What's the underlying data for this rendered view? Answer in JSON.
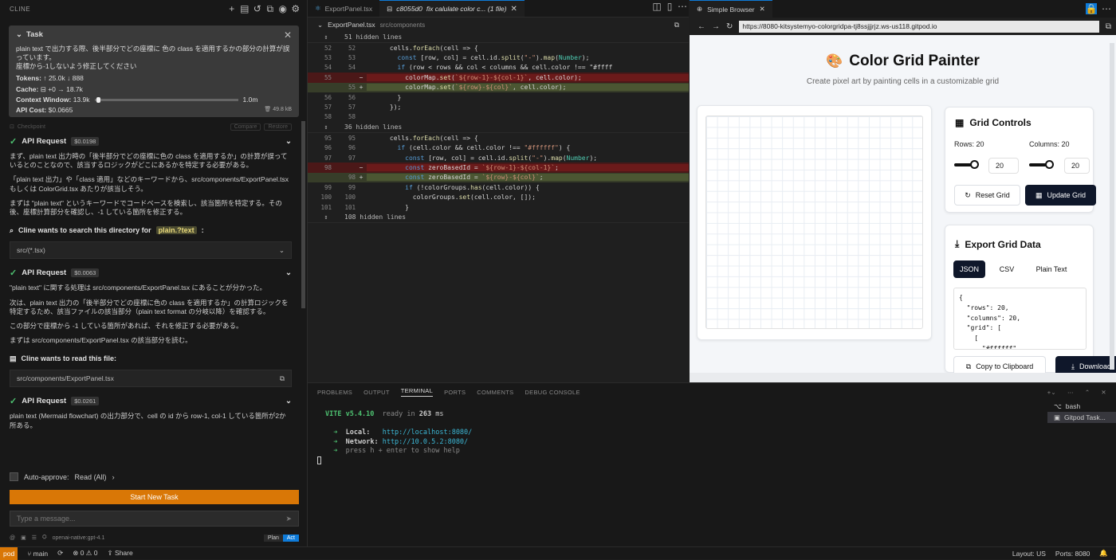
{
  "left": {
    "header_title": "CLINE",
    "task": {
      "title": "Task",
      "text_1": "plain text で出力する際、後半部分でどの座標に 色の class を適用するかの部分の計算が誤っています。",
      "text_2": "座標から-1しないよう修正してください",
      "tokens_label": "Tokens:",
      "tokens_value": "↑ 25.0k ↓ 888",
      "cache_label": "Cache:",
      "cache_value": "⊟ +0 → 18.7k",
      "context_label": "Context Window:",
      "context_used": "13.9k",
      "context_max": "1.0m",
      "context_fraction": 0.013,
      "cost_label": "API Cost:",
      "cost_value": "$0.0665",
      "size": "49.8 kB"
    },
    "checkpoint": {
      "label": "Checkpoint",
      "compare": "Compare",
      "restore": "Restore"
    },
    "chat": {
      "req1_title": "API Request",
      "req1_cost": "$0.0198",
      "msg1": "まず、plain text 出力時の「後半部分でどの座標に色の class を適用するか」の計算が誤っているとのことなので、該当するロジックがどこにあるかを特定する必要がある。",
      "msg2": "「plain text 出力」や「class 適用」などのキーワードから、src/components/ExportPanel.tsx もしくは ColorGrid.tsx あたりが該当しそう。",
      "msg3": "まずは \"plain text\" というキーワードでコードベースを検索し、該当箇所を特定する。その後、座標計算部分を確認し、-1 している箇所を修正する。",
      "search_title": "Cline wants to search this directory for",
      "search_term": "plain.?text",
      "search_pattern": "src/(*.tsx)",
      "req2_title": "API Request",
      "req2_cost": "$0.0063",
      "msg4": "\"plain text\" に関する処理は src/components/ExportPanel.tsx にあることが分かった。",
      "msg5": "次は、plain text 出力の「後半部分でどの座標に色の class を適用するか」の計算ロジックを特定するため、該当ファイルの該当部分（plain text format の分岐以降）を確認する。",
      "msg6": "この部分で座標から -1 している箇所があれば、それを修正する必要がある。",
      "msg7": "まずは src/components/ExportPanel.tsx の該当部分を読む。",
      "read_title": "Cline wants to read this file:",
      "read_path": "src/components/ExportPanel.tsx",
      "req3_title": "API Request",
      "req3_cost": "$0.0261",
      "msg8": "plain text (Mermaid flowchart) の出力部分で、cell の id から row-1, col-1 している箇所が2か所ある。"
    },
    "auto_approve": "Auto-approve:",
    "auto_approve_value": "Read (All)",
    "new_task": "Start New Task",
    "message_placeholder": "Type a message...",
    "model": "openai-native:gpt-4.1",
    "plan": "Plan",
    "act": "Act"
  },
  "editor": {
    "tab1": "ExportPanel.tsx",
    "tab2_hash": "c8055d0",
    "tab2_msg": "fix calulate color c... (1 file)",
    "file": "ExportPanel.tsx",
    "path": "src/components",
    "hidden1": "51 hidden lines",
    "hidden2": "36 hidden lines",
    "hidden3": "108 hidden lines",
    "lines": [
      {
        "a": "52",
        "b": "52",
        "m": "",
        "t": "normal",
        "code": "      cells.forEach(cell => {"
      },
      {
        "a": "53",
        "b": "53",
        "m": "",
        "t": "normal",
        "code": "        const [row, col] = cell.id.split(\"-\").map(Number);"
      },
      {
        "a": "54",
        "b": "54",
        "m": "",
        "t": "normal",
        "code": "        if (row < rows && col < columns && cell.color !== \"#ffff"
      },
      {
        "a": "55",
        "b": "",
        "m": "−",
        "t": "del",
        "code": "          colorMap.set(`${row-1}-${col-1}`, cell.color);"
      },
      {
        "a": "",
        "b": "55",
        "m": "+",
        "t": "add",
        "code": "          colorMap.set(`${row}-${col}`, cell.color);"
      },
      {
        "a": "56",
        "b": "56",
        "m": "",
        "t": "normal",
        "code": "        }"
      },
      {
        "a": "57",
        "b": "57",
        "m": "",
        "t": "normal",
        "code": "      });"
      },
      {
        "a": "58",
        "b": "58",
        "m": "",
        "t": "normal",
        "code": ""
      }
    ],
    "lines2": [
      {
        "a": "95",
        "b": "95",
        "m": "",
        "t": "normal",
        "code": "      cells.forEach(cell => {"
      },
      {
        "a": "96",
        "b": "96",
        "m": "",
        "t": "normal",
        "code": "        if (cell.color && cell.color !== \"#ffffff\") {"
      },
      {
        "a": "97",
        "b": "97",
        "m": "",
        "t": "normal",
        "code": "          const [row, col] = cell.id.split(\"-\").map(Number);"
      },
      {
        "a": "98",
        "b": "",
        "m": "−",
        "t": "del",
        "code": "          const zeroBasedId = `${row-1}-${col-1}`;"
      },
      {
        "a": "",
        "b": "98",
        "m": "+",
        "t": "add",
        "code": "          const zeroBasedId = `${row}-${col}`;"
      },
      {
        "a": "99",
        "b": "99",
        "m": "",
        "t": "normal",
        "code": "          if (!colorGroups.has(cell.color)) {"
      },
      {
        "a": "100",
        "b": "100",
        "m": "",
        "t": "normal",
        "code": "            colorGroups.set(cell.color, []);"
      },
      {
        "a": "101",
        "b": "101",
        "m": "",
        "t": "normal",
        "code": "          }"
      }
    ]
  },
  "browser": {
    "tab": "Simple Browser",
    "url": "https://8080-kitsystemyo-colorgridpa-tj8ssjjjrjz.ws-us118.gitpod.io",
    "title": "Color Grid Painter",
    "subtitle": "Create pixel art by painting cells in a customizable grid",
    "controls_title": "Grid Controls",
    "rows_label": "Rows: 20",
    "cols_label": "Columns: 20",
    "rows_value": "20",
    "cols_value": "20",
    "reset": "Reset Grid",
    "update": "Update Grid",
    "export_title": "Export Grid Data",
    "fmt_json": "JSON",
    "fmt_csv": "CSV",
    "fmt_plain": "Plain Text",
    "json_preview": "{\n  \"rows\": 20,\n  \"columns\": 20,\n  \"grid\": [\n    [\n      \"#ffffff\"",
    "copy": "Copy to Clipboard",
    "download": "Download"
  },
  "panel": {
    "tabs": [
      "PROBLEMS",
      "OUTPUT",
      "TERMINAL",
      "PORTS",
      "COMMENTS",
      "DEBUG CONSOLE"
    ],
    "active": "TERMINAL",
    "vite": "VITE v5.4.10",
    "ready": "ready in",
    "ready_ms": "263",
    "ms": "ms",
    "local_label": "Local:",
    "local_url": "http://localhost:8080/",
    "network_label": "Network:",
    "network_url": "http://10.0.5.2:8080/",
    "help": "press h + enter to show help",
    "terminals": [
      "bash",
      "Gitpod Task..."
    ]
  },
  "status": {
    "remote": "pod",
    "branch": "main",
    "problems": "⊗ 0 ⚠ 0",
    "share": "Share",
    "layout": "Layout: US",
    "ports": "Ports: 8080"
  }
}
